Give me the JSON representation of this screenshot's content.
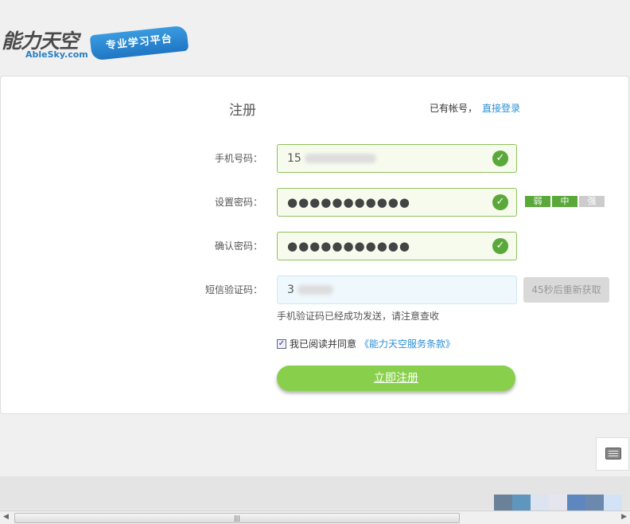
{
  "logo": {
    "name_cn": "能力天空",
    "name_en": "AbleSky.com",
    "slogan": "专业学习平台"
  },
  "form": {
    "title": "注册",
    "have_account": "已有帐号，",
    "login_link": "直接登录",
    "phone": {
      "label": "手机号码：",
      "value": "15"
    },
    "password": {
      "label": "设置密码：",
      "value": "●●●●●●●●●●●"
    },
    "confirm": {
      "label": "确认密码：",
      "value": "●●●●●●●●●●●"
    },
    "sms": {
      "label": "短信验证码：",
      "value": "3",
      "resend": "45秒后重新获取",
      "hint": "手机验证码已经成功发送，请注意查收"
    },
    "strength": [
      "弱",
      "中",
      "强"
    ],
    "agree_text": "我已阅读并同意",
    "terms_link": "《能力天空服务条款》",
    "submit": "立即注册"
  },
  "colors": {
    "accent": "#88d04b",
    "valid": "#5aa83a",
    "link": "#2a8fd6"
  }
}
